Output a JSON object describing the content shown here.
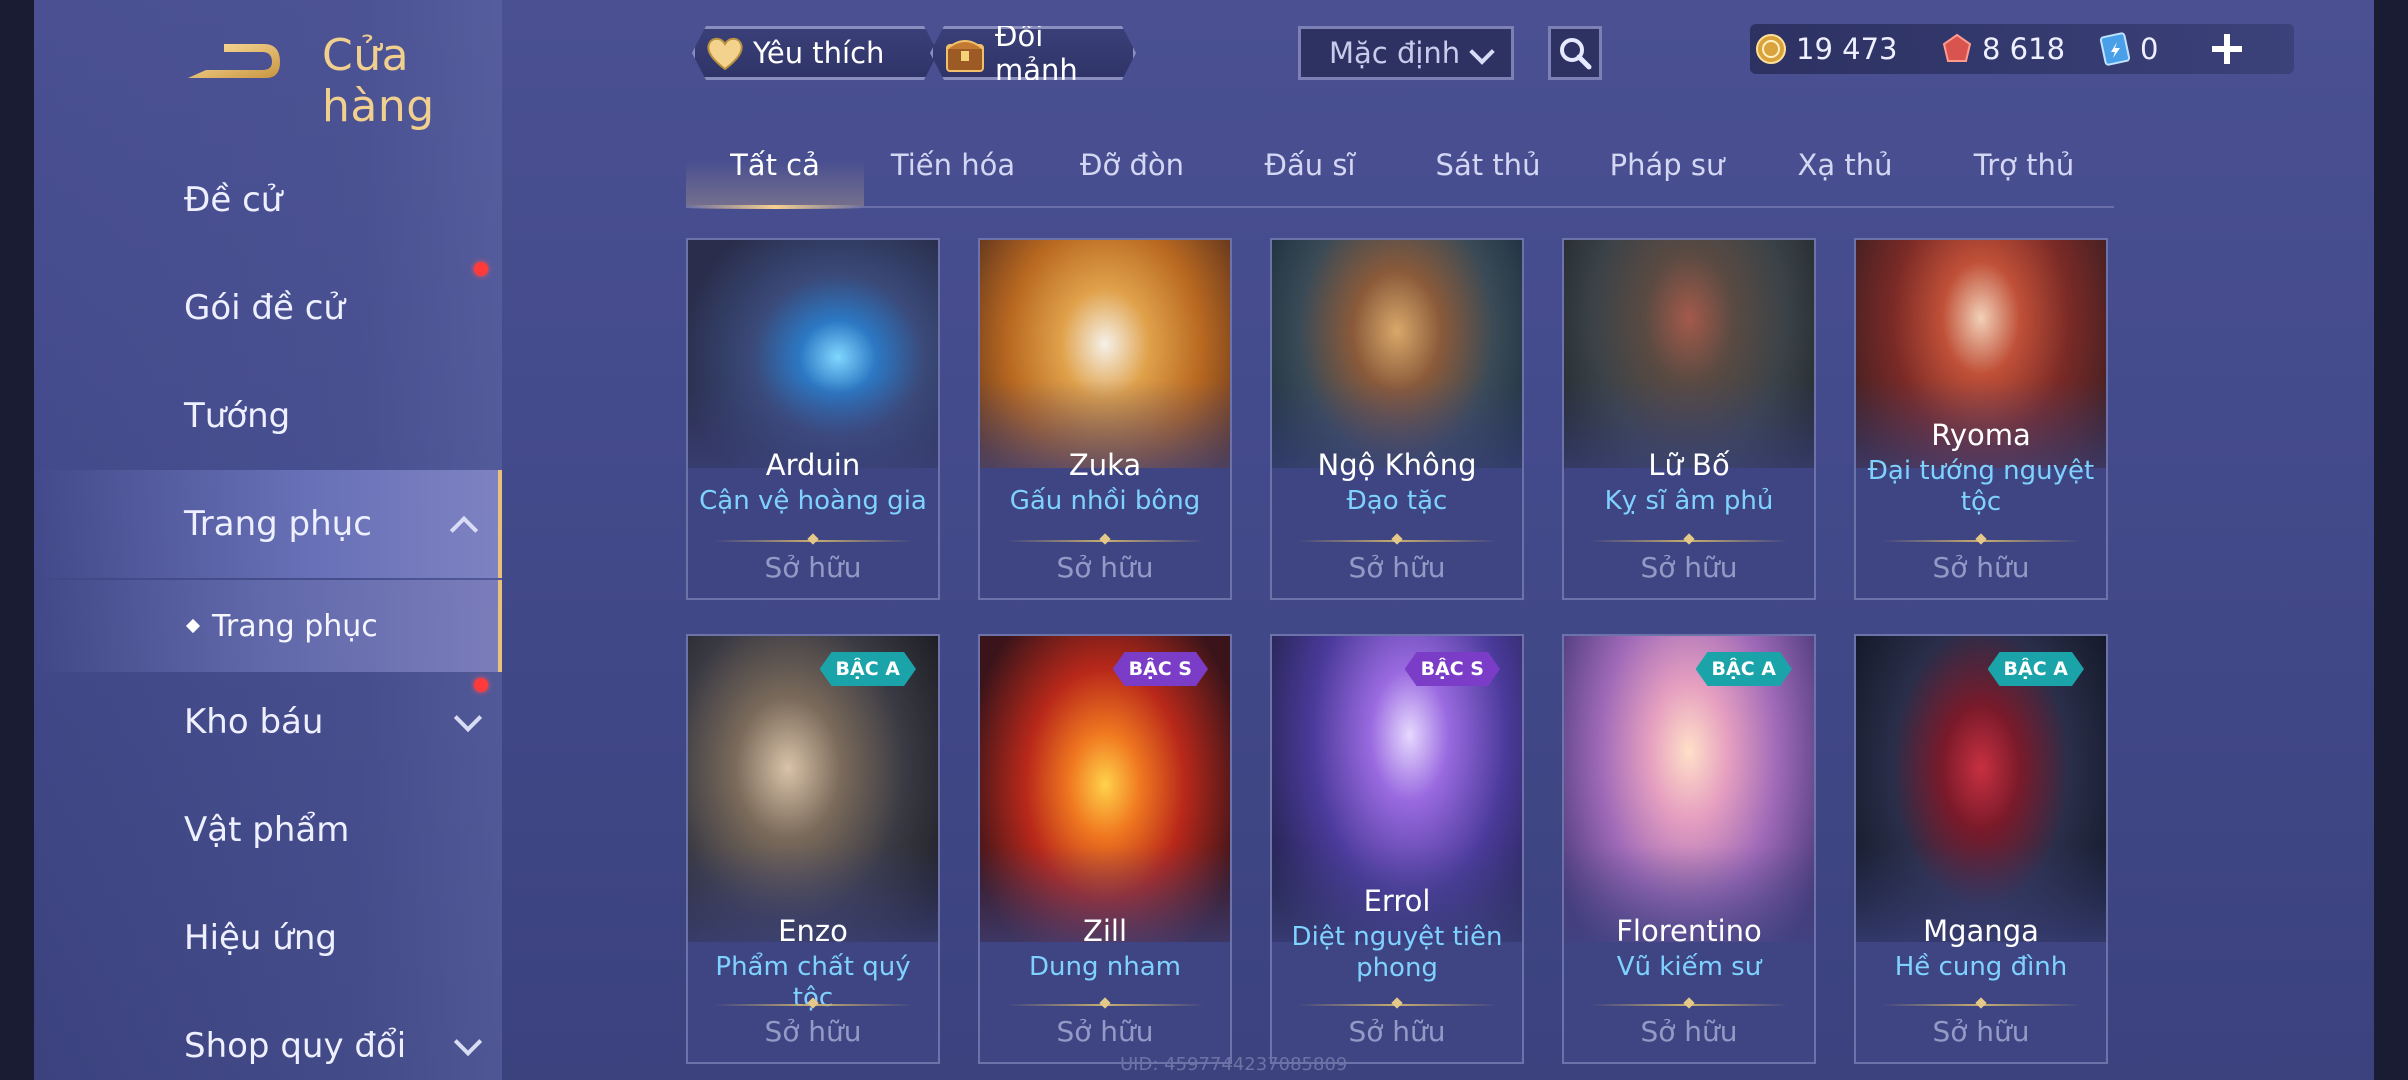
{
  "header": {
    "title": "Cửa hàng",
    "favorite_label": "Yêu thích",
    "exchange_label": "Đổi mảnh",
    "sort": {
      "selected": "Mặc định"
    }
  },
  "currency": [
    {
      "icon": "gold-coin-icon",
      "value": "19 473"
    },
    {
      "icon": "ruby-gem-icon",
      "value": "8 618"
    },
    {
      "icon": "voucher-icon",
      "value": "0"
    }
  ],
  "sidebar": {
    "items": [
      {
        "label": "Đề cử"
      },
      {
        "label": "Gói đề cử"
      },
      {
        "label": "Tướng"
      },
      {
        "label": "Trang phục"
      },
      {
        "label": "Kho báu"
      },
      {
        "label": "Vật phẩm"
      },
      {
        "label": "Hiệu ứng"
      },
      {
        "label": "Shop quy đổi"
      }
    ],
    "sub_item": {
      "label": "Trang phục"
    }
  },
  "tabs": [
    {
      "label": "Tất cả"
    },
    {
      "label": "Tiến hóa"
    },
    {
      "label": "Đỡ đòn"
    },
    {
      "label": "Đấu sĩ"
    },
    {
      "label": "Sát thủ"
    },
    {
      "label": "Pháp sư"
    },
    {
      "label": "Xạ thủ"
    },
    {
      "label": "Trợ thủ"
    }
  ],
  "cards": [
    {
      "hero": "Arduin",
      "skin": "Cận vệ hoàng gia",
      "status": "Sở hữu",
      "badge": ""
    },
    {
      "hero": "Zuka",
      "skin": "Gấu nhồi bông",
      "status": "Sở hữu",
      "badge": ""
    },
    {
      "hero": "Ngộ Không",
      "skin": "Đạo tặc",
      "status": "Sở hữu",
      "badge": ""
    },
    {
      "hero": "Lữ Bố",
      "skin": "Kỵ sĩ âm phủ",
      "status": "Sở hữu",
      "badge": ""
    },
    {
      "hero": "Ryoma",
      "skin": "Đại tướng nguyệt tộc",
      "status": "Sở hữu",
      "badge": ""
    },
    {
      "hero": "Enzo",
      "skin": "Phẩm chất quý tộc",
      "status": "Sở hữu",
      "badge": "BẬC A"
    },
    {
      "hero": "Zill",
      "skin": "Dung nham",
      "status": "Sở hữu",
      "badge": "BẬC S"
    },
    {
      "hero": "Errol",
      "skin": "Diệt nguyệt tiên phong",
      "status": "Sở hữu",
      "badge": "BẬC S"
    },
    {
      "hero": "Florentino",
      "skin": "Vũ kiếm sư",
      "status": "Sở hữu",
      "badge": "BẬC A"
    },
    {
      "hero": "Mganga",
      "skin": "Hề cung đình",
      "status": "Sở hữu",
      "badge": "BẬC A"
    }
  ],
  "footer": {
    "uid": "UID: 4597744237085809"
  },
  "colors": {
    "accent_gold": "#f1cf8e",
    "skin_name": "#7fd2ff",
    "badge_a": "#1aa3a8",
    "badge_s": "#7b3cc7",
    "notify": "#ff3a3a"
  }
}
